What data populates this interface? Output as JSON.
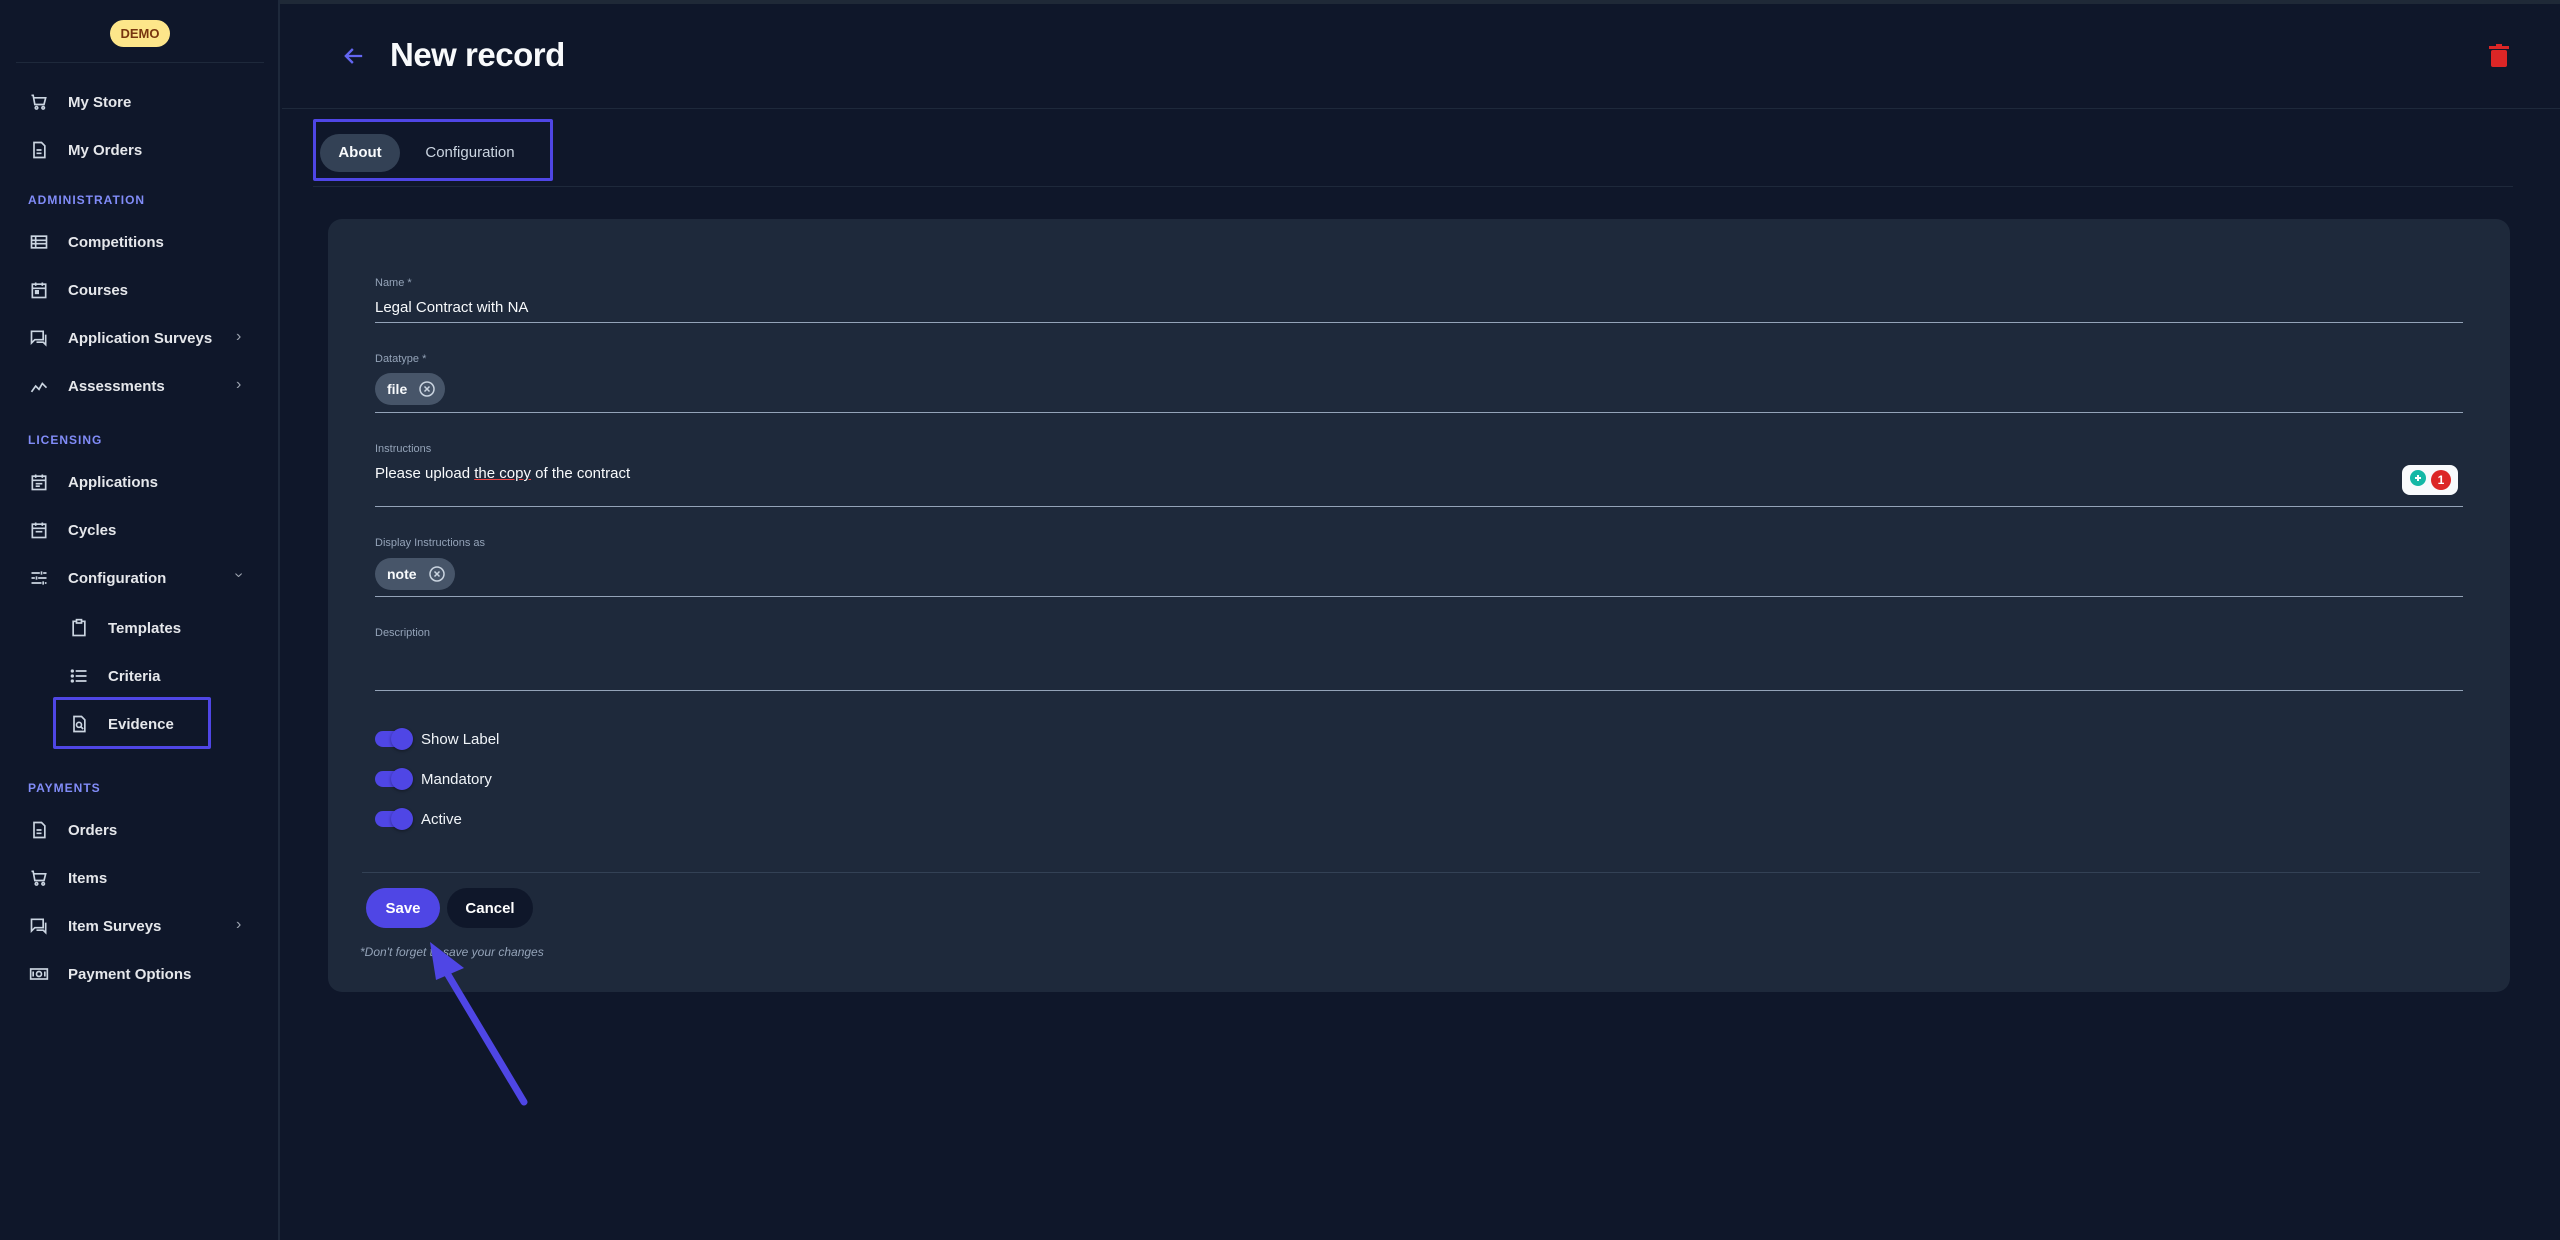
{
  "app": {
    "badge": "DEMO"
  },
  "sidebar": {
    "items_top": [
      {
        "label": "My Store",
        "icon": "cart-icon"
      },
      {
        "label": "My Orders",
        "icon": "document-icon"
      }
    ],
    "sections": {
      "administration": "ADMINISTRATION",
      "licensing": "LICENSING",
      "payments": "PAYMENTS"
    },
    "administration": [
      {
        "label": "Competitions",
        "icon": "list-icon"
      },
      {
        "label": "Courses",
        "icon": "calendar-icon"
      },
      {
        "label": "Application Surveys",
        "icon": "survey-icon"
      },
      {
        "label": "Assessments",
        "icon": "chart-line-icon"
      }
    ],
    "licensing": [
      {
        "label": "Applications",
        "icon": "calendar-icon"
      },
      {
        "label": "Cycles",
        "icon": "calendar-icon"
      },
      {
        "label": "Configuration",
        "icon": "sliders-icon"
      }
    ],
    "configuration_sub": [
      {
        "label": "Templates",
        "icon": "clipboard-icon"
      },
      {
        "label": "Criteria",
        "icon": "list-bullets-icon"
      },
      {
        "label": "Evidence",
        "icon": "file-search-icon"
      }
    ],
    "payments": [
      {
        "label": "Orders",
        "icon": "document-icon"
      },
      {
        "label": "Items",
        "icon": "cart-icon"
      },
      {
        "label": "Item Surveys",
        "icon": "survey-icon"
      },
      {
        "label": "Payment Options",
        "icon": "cash-icon"
      }
    ]
  },
  "header": {
    "title": "New record"
  },
  "tabs": [
    {
      "label": "About",
      "active": true
    },
    {
      "label": "Configuration",
      "active": false
    }
  ],
  "form": {
    "name": {
      "label": "Name *",
      "value": "Legal Contract with NA"
    },
    "datatype": {
      "label": "Datatype *",
      "chip": "file"
    },
    "instructions": {
      "label": "Instructions",
      "value_pre": "Please upload ",
      "value_underlined": "the copy",
      "value_post": " of the contract",
      "grammar_count": "1"
    },
    "display_as": {
      "label": "Display Instructions as",
      "chip": "note"
    },
    "description": {
      "label": "Description",
      "value": ""
    },
    "toggles": [
      {
        "label": "Show Label",
        "on": true
      },
      {
        "label": "Mandatory",
        "on": true
      },
      {
        "label": "Active",
        "on": true
      }
    ],
    "save_label": "Save",
    "cancel_label": "Cancel",
    "hint": "*Don't forget to save your changes"
  },
  "colors": {
    "accent": "#4f46e5",
    "background": "#0f172a",
    "card": "#1e293b",
    "danger": "#ef4444"
  }
}
